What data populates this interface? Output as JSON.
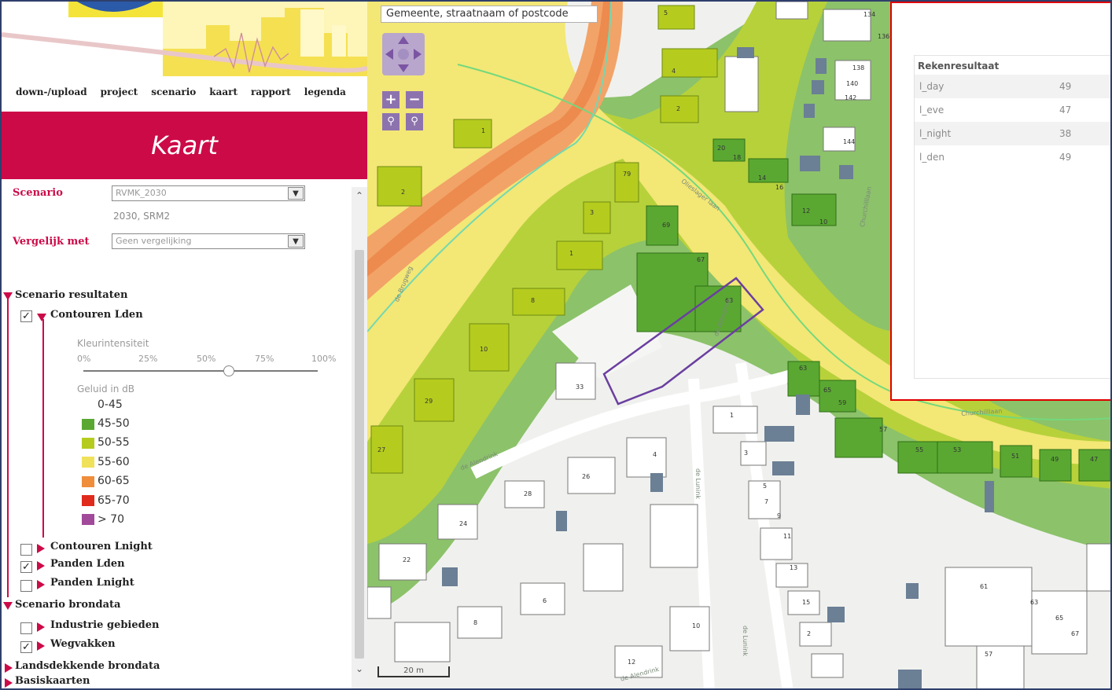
{
  "nav": {
    "items": [
      "down-/upload",
      "project",
      "scenario",
      "kaart",
      "rapport",
      "legenda"
    ]
  },
  "panel": {
    "title": "Kaart",
    "scenario_label": "Scenario",
    "scenario_value": "RVMK_2030",
    "scenario_sub": "2030, SRM2",
    "compare_label": "Vergelijk met",
    "compare_value": "Geen vergelijking"
  },
  "tree": {
    "scenario_results": "Scenario resultaten",
    "contours_lden": "Contouren Lden",
    "intensity_label": "Kleurintensiteit",
    "slider_ticks": [
      "0%",
      "25%",
      "50%",
      "75%",
      "100%"
    ],
    "slider_value_pct": 62,
    "sound_label": "Geluid in dB",
    "legend": [
      {
        "label": "0-45",
        "color": ""
      },
      {
        "label": "45-50",
        "color": "#5aa832"
      },
      {
        "label": "50-55",
        "color": "#b5cc1f"
      },
      {
        "label": "55-60",
        "color": "#f0e15a"
      },
      {
        "label": "60-65",
        "color": "#ef8d3a"
      },
      {
        "label": "65-70",
        "color": "#e02a1c"
      },
      {
        "label": "> 70",
        "color": "#a24a9a"
      }
    ],
    "contours_lnight": "Contouren Lnight",
    "panden_lden": "Panden Lden",
    "panden_lnight": "Panden Lnight",
    "scenario_source": "Scenario brondata",
    "industry": "Industrie gebieden",
    "road_segments": "Wegvakken",
    "national_source": "Landsdekkende brondata",
    "base_maps": "Basiskaarten"
  },
  "map": {
    "search_placeholder": "Gemeente, straatnaam of postcode",
    "scale_label": "20 m",
    "street_labels": [
      "de Brugweg",
      "de Alendrink",
      "de Alendrink",
      "de Lunink",
      "de Lunink",
      "de Alendrink",
      "Churchilllaan",
      "Churchilllaan",
      "Olieslager laan"
    ],
    "house_numbers": [
      "5",
      "134",
      "136",
      "4",
      "2",
      "1",
      "2",
      "138",
      "140",
      "142",
      "144",
      "20",
      "18",
      "14",
      "16",
      "12",
      "10",
      "79",
      "3",
      "69",
      "1",
      "67",
      "8",
      "63",
      "10",
      "33",
      "29",
      "27",
      "63",
      "65",
      "59",
      "57",
      "55",
      "53",
      "51",
      "49",
      "47",
      "1",
      "3",
      "5",
      "7",
      "9",
      "11",
      "13",
      "15",
      "2",
      "4",
      "26",
      "28",
      "24",
      "22",
      "61",
      "63",
      "65",
      "67",
      "57",
      "6",
      "8",
      "10",
      "12"
    ]
  },
  "result": {
    "heading": "Rekenresultaat",
    "rows": [
      {
        "key": "l_day",
        "value": "49"
      },
      {
        "key": "l_eve",
        "value": "47"
      },
      {
        "key": "l_night",
        "value": "38"
      },
      {
        "key": "l_den",
        "value": "49"
      }
    ]
  }
}
